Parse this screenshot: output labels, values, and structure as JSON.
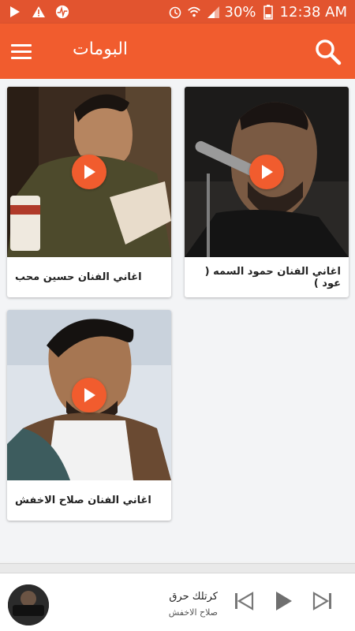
{
  "status_bar": {
    "time": "12:38 AM",
    "battery": "30%",
    "icons": [
      "play-store-icon",
      "warning-icon",
      "beat-app-icon",
      "alarm-icon",
      "wifi-icon",
      "signal-icon",
      "battery-icon"
    ]
  },
  "app_bar": {
    "title": "البومات",
    "menu_icon": "hamburger-menu-icon",
    "search_icon": "search-icon"
  },
  "albums": [
    {
      "label": "اغاني الفنان حمود السمه ( عود )",
      "icon": "play-icon"
    },
    {
      "label": "اغاني الفنان حسين محب",
      "icon": "play-icon"
    },
    {
      "label": "اغاني الفنان صلاح الاخفش",
      "icon": "play-icon"
    }
  ],
  "now_playing": {
    "title": "كرتلك حرق",
    "artist": "صلاح الاخفش",
    "thumb_text": "كرتلك حرق",
    "controls": [
      "previous-icon",
      "play-icon",
      "next-icon"
    ]
  },
  "colors": {
    "status_bar": "#e2542f",
    "app_bar": "#f15c2e",
    "accent": "#f15c2e",
    "background": "#f3f4f6"
  }
}
